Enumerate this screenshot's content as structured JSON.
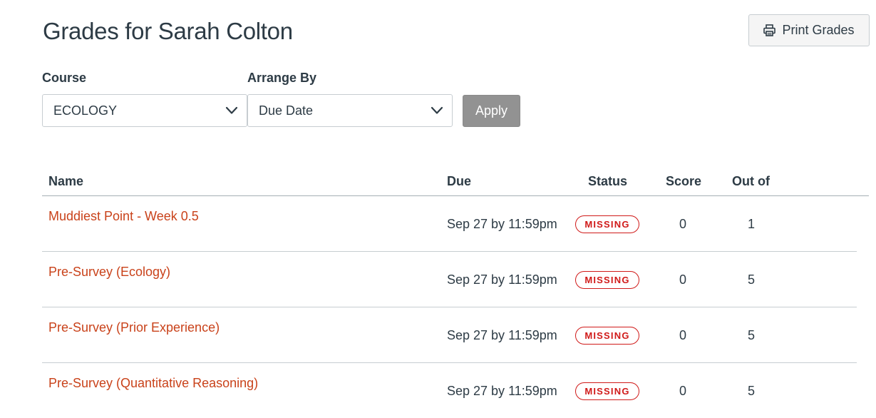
{
  "page": {
    "title": "Grades for Sarah Colton"
  },
  "toolbar": {
    "print_label": "Print Grades"
  },
  "filters": {
    "course_label": "Course",
    "course_value": "ECOLOGY",
    "arrange_label": "Arrange By",
    "arrange_value": "Due Date",
    "apply_label": "Apply"
  },
  "table": {
    "headers": {
      "name": "Name",
      "due": "Due",
      "status": "Status",
      "score": "Score",
      "out_of": "Out of"
    },
    "rows": [
      {
        "name": "Muddiest Point - Week 0.5",
        "due": "Sep 27 by 11:59pm",
        "status": "MISSING",
        "score": "0",
        "out_of": "1"
      },
      {
        "name": "Pre-Survey (Ecology)",
        "due": "Sep 27 by 11:59pm",
        "status": "MISSING",
        "score": "0",
        "out_of": "5"
      },
      {
        "name": "Pre-Survey (Prior Experience)",
        "due": "Sep 27 by 11:59pm",
        "status": "MISSING",
        "score": "0",
        "out_of": "5"
      },
      {
        "name": "Pre-Survey (Quantitative Reasoning)",
        "due": "Sep 27 by 11:59pm",
        "status": "MISSING",
        "score": "0",
        "out_of": "5"
      }
    ]
  },
  "colors": {
    "link": "#c9421a",
    "missing": "#d01a19",
    "text": "#2d3b45",
    "apply_bg": "#929292"
  },
  "icons": {
    "print": "printer-icon",
    "dropdown": "chevron-down-icon"
  }
}
